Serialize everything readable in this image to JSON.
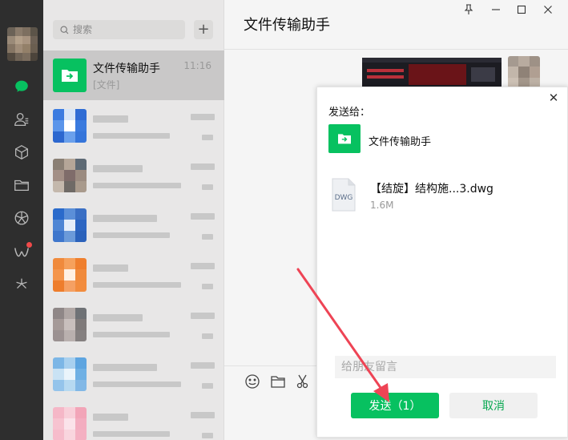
{
  "search": {
    "placeholder": "搜索"
  },
  "list": {
    "add_label": "+",
    "active_chat": {
      "name": "文件传输助手",
      "time": "11:16",
      "preview": "[文件]"
    }
  },
  "main": {
    "title": "文件传输助手"
  },
  "window_controls": {
    "pin": "⊥",
    "min": "—",
    "max": "☐",
    "close": "✕"
  },
  "dialog": {
    "title": "发送给：",
    "recipient": "文件传输助手",
    "close": "✕",
    "file": {
      "type": "DWG",
      "name": "【结旋】结构施...3.dwg",
      "size": "1.6M"
    },
    "message_placeholder": "给朋友留言",
    "send_label": "发送（1）",
    "cancel_label": "取消"
  },
  "colors": {
    "accent": "#07c160",
    "rail": "#2e2e2e",
    "arrow": "#ee4455"
  },
  "icons": [
    "chat-icon",
    "contacts-icon",
    "cube-icon",
    "folder-icon",
    "moments-icon",
    "weixin-icon",
    "sparkle-icon"
  ]
}
